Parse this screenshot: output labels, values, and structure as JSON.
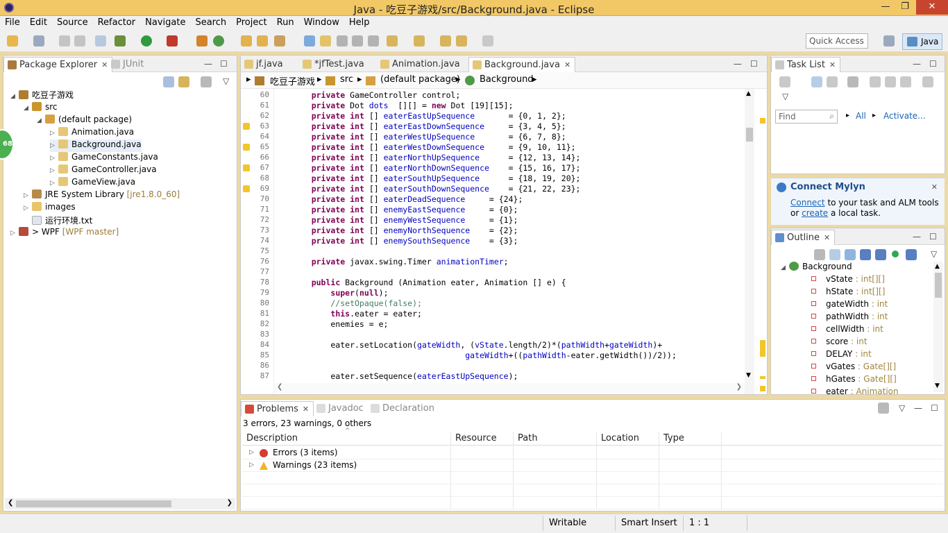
{
  "window": {
    "title": "Java - 吃豆子游戏/src/Background.java - Eclipse",
    "minimize": "—",
    "maximize": "❐",
    "close": "✕"
  },
  "menu": [
    "File",
    "Edit",
    "Source",
    "Refactor",
    "Navigate",
    "Search",
    "Project",
    "Run",
    "Window",
    "Help"
  ],
  "toolbar": {
    "quick_access_placeholder": "Quick Access",
    "perspective": "Java"
  },
  "package_explorer": {
    "tabs": [
      {
        "label": "Package Explorer"
      },
      {
        "label": "JUnit"
      }
    ],
    "tree": [
      {
        "label": "吃豆子游戏",
        "expanded": true
      },
      {
        "label": "src",
        "expanded": true
      },
      {
        "label": "(default package)",
        "expanded": true
      },
      {
        "label": "Animation.java"
      },
      {
        "label": "Background.java"
      },
      {
        "label": "GameConstants.java"
      },
      {
        "label": "GameController.java"
      },
      {
        "label": "GameView.java"
      },
      {
        "label": "JRE System Library",
        "decoration": "[jre1.8.0_60]"
      },
      {
        "label": "images"
      },
      {
        "label": "运行环境.txt"
      },
      {
        "label": "> WPF",
        "decoration": "[WPF master]"
      }
    ],
    "badge": "68"
  },
  "editor": {
    "tabs": [
      "jf.java",
      "*jfTest.java",
      "Animation.java",
      "Background.java"
    ],
    "breadcrumb": [
      "吃豆子游戏",
      "src",
      "(default package)",
      "Background"
    ],
    "lines": [
      {
        "n": "60",
        "t": "    private GameController control;"
      },
      {
        "n": "61",
        "t": "    private Dot dots  [][] = new Dot [19][15];"
      },
      {
        "n": "62",
        "t": "    private int [] eaterEastUpSequence       = {0, 1, 2};"
      },
      {
        "n": "63",
        "t": "    private int [] eaterEastDownSequence     = {3, 4, 5};"
      },
      {
        "n": "64",
        "t": "    private int [] eaterWestUpSequence       = {6, 7, 8};"
      },
      {
        "n": "65",
        "t": "    private int [] eaterWestDownSequence     = {9, 10, 11};"
      },
      {
        "n": "66",
        "t": "    private int [] eaterNorthUpSequence      = {12, 13, 14};"
      },
      {
        "n": "67",
        "t": "    private int [] eaterNorthDownSequence    = {15, 16, 17};"
      },
      {
        "n": "68",
        "t": "    private int [] eaterSouthUpSequence      = {18, 19, 20};"
      },
      {
        "n": "69",
        "t": "    private int [] eaterSouthDownSequence    = {21, 22, 23};"
      },
      {
        "n": "70",
        "t": "    private int [] eaterDeadSequence     = {24};"
      },
      {
        "n": "71",
        "t": "    private int [] enemyEastSequence     = {0};"
      },
      {
        "n": "72",
        "t": "    private int [] enemyWestSequence     = {1};"
      },
      {
        "n": "73",
        "t": "    private int [] enemyNorthSequence    = {2};"
      },
      {
        "n": "74",
        "t": "    private int [] enemySouthSequence    = {3};"
      },
      {
        "n": "75",
        "t": ""
      },
      {
        "n": "76",
        "t": "    private javax.swing.Timer animationTimer;"
      },
      {
        "n": "77",
        "t": ""
      },
      {
        "n": "78",
        "t": "    public Background (Animation eater, Animation [] e) {"
      },
      {
        "n": "79",
        "t": "        super(null);"
      },
      {
        "n": "80",
        "t": "        //setOpaque(false);"
      },
      {
        "n": "81",
        "t": "        this.eater = eater;"
      },
      {
        "n": "82",
        "t": "        enemies = e;"
      },
      {
        "n": "83",
        "t": ""
      },
      {
        "n": "84",
        "t": "        eater.setLocation(gateWidth, (vState.length/2)*(pathWidth+gateWidth)+"
      },
      {
        "n": "85",
        "t": "                                    gateWidth+((pathWidth-eater.getWidth())/2));"
      },
      {
        "n": "86",
        "t": ""
      },
      {
        "n": "87",
        "t": "        eater.setSequence(eaterEastUpSequence);"
      }
    ]
  },
  "task_list": {
    "tab": "Task List",
    "find_placeholder": "Find",
    "all": "All",
    "activate": "Activate..."
  },
  "mylyn": {
    "title": "Connect Mylyn",
    "connect": "Connect",
    "text1": " to your task and ALM tools",
    "or": "or ",
    "create": "create",
    "text2": " a local task."
  },
  "outline": {
    "tab": "Outline",
    "root": "Background",
    "items": [
      {
        "name": "vState",
        "type": " : int[][]"
      },
      {
        "name": "hState",
        "type": " : int[][]"
      },
      {
        "name": "gateWidth",
        "type": " : int"
      },
      {
        "name": "pathWidth",
        "type": " : int"
      },
      {
        "name": "cellWidth",
        "type": " : int"
      },
      {
        "name": "score",
        "type": " : int"
      },
      {
        "name": "DELAY",
        "type": " : int"
      },
      {
        "name": "vGates",
        "type": " : Gate[][]"
      },
      {
        "name": "hGates",
        "type": " : Gate[][]"
      },
      {
        "name": "eater",
        "type": " : Animation"
      }
    ]
  },
  "problems": {
    "tabs": [
      "Problems",
      "Javadoc",
      "Declaration"
    ],
    "summary": "3 errors, 23 warnings, 0 others",
    "columns": [
      "Description",
      "Resource",
      "Path",
      "Location",
      "Type"
    ],
    "rows": [
      {
        "label": "Errors (3 items)"
      },
      {
        "label": "Warnings (23 items)"
      }
    ]
  },
  "status": {
    "writable": "Writable",
    "insert": "Smart Insert",
    "position": "1 : 1"
  }
}
